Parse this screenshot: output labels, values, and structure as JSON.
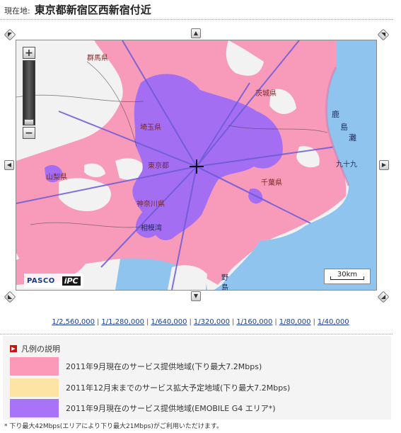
{
  "location": {
    "label": "現在地:",
    "value": "東京都新宿区西新宿付近"
  },
  "map": {
    "place_labels": [
      "群馬県",
      "茨城県",
      "埼玉県",
      "鹿",
      "島",
      "灘",
      "東京都",
      "九十九",
      "山梨県",
      "千葉県",
      "神奈川県",
      "相模湾",
      "野",
      "島"
    ],
    "scale_bar": "30km",
    "credits": {
      "pasco": "PASCO",
      "ipc": "iPC"
    },
    "colors": {
      "sea": "#8fc4ee",
      "land": "#f2f2f2",
      "service_current": "#f89ab9",
      "service_planned": "#fde4a6",
      "service_g4": "#a36ef2",
      "roads": "#6b5bd8"
    }
  },
  "zoom_control": {
    "in_symbol": "+",
    "out_symbol": "−"
  },
  "scales": [
    "1/2,560,000",
    "1/1,280,000",
    "1/640,000",
    "1/320,000",
    "1/160,000",
    "1/80,000",
    "1/40,000"
  ],
  "legend": {
    "title": "凡例の説明",
    "items": [
      {
        "color": "#fd99b8",
        "label": "2011年9月現在のサービス提供地域(下り最大7.2Mbps)"
      },
      {
        "color": "#fde3a4",
        "label": "2011年12月末までのサービス拡大予定地域(下り最大7.2Mbps)"
      },
      {
        "color": "#a874f7",
        "label": "2011年9月現在のサービス提供地域(EMOBILE G4 エリア*)"
      }
    ]
  },
  "note": "* 下り最大42Mbps(エリアにより下り最大21Mbps)がご利用いただけます。"
}
